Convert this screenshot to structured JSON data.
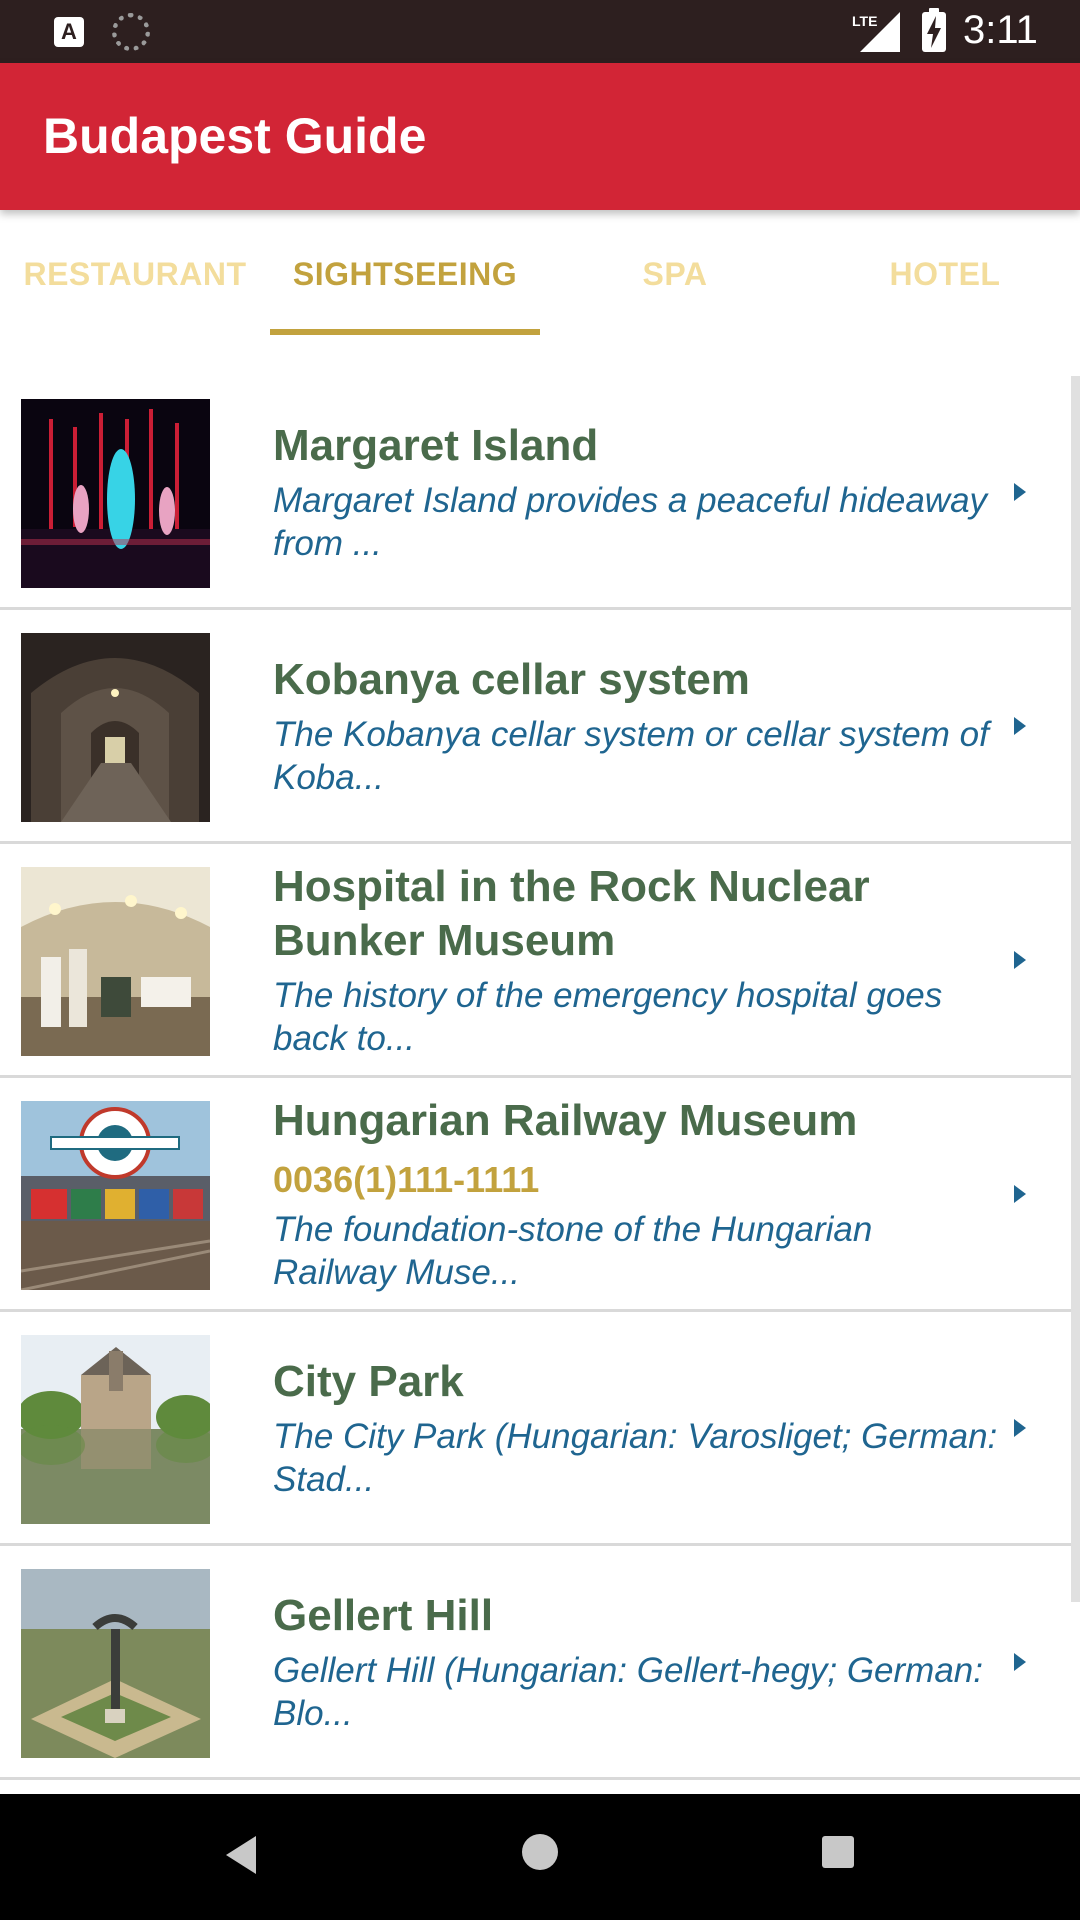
{
  "status_bar": {
    "time": "3:11",
    "network": "LTE"
  },
  "app_bar": {
    "title": "Budapest Guide"
  },
  "tabs": [
    {
      "label": "RESTAURANT"
    },
    {
      "label": "SIGHTSEEING"
    },
    {
      "label": "SPA"
    },
    {
      "label": "HOTEL"
    }
  ],
  "active_tab": "SIGHTSEEING",
  "items": [
    {
      "title": "Margaret Island",
      "desc": "Margaret Island provides a peaceful hideaway from ..."
    },
    {
      "title": "Kobanya cellar system",
      "desc": "The Kobanya cellar system or cellar system of Koba..."
    },
    {
      "title": "Hospital in the Rock Nuclear Bunker Museum",
      "desc": "The history of the emergency hospital goes back to..."
    },
    {
      "title": "Hungarian Railway Museum",
      "phone": "0036(1)111-1111",
      "desc": "The foundation-stone of the Hungarian Railway Muse..."
    },
    {
      "title": "City Park",
      "desc": "The City Park (Hungarian: Varosliget; German: Stad..."
    },
    {
      "title": "Gellert Hill",
      "desc": "Gellert Hill (Hungarian: Gellert-hegy; German: Blo..."
    }
  ],
  "colors": {
    "app_bar": "#d22536",
    "tab_active": "#c2a23e",
    "tab_inactive": "#f3dd9c",
    "item_title": "#4a6b4b",
    "item_desc": "#1f6590",
    "phone": "#c2a23e"
  },
  "icons": [
    "app-a-icon",
    "loading-spinner-icon",
    "lte-signal-icon",
    "battery-charging-icon",
    "chevron-right-icon",
    "back-icon",
    "home-icon",
    "recents-icon"
  ]
}
